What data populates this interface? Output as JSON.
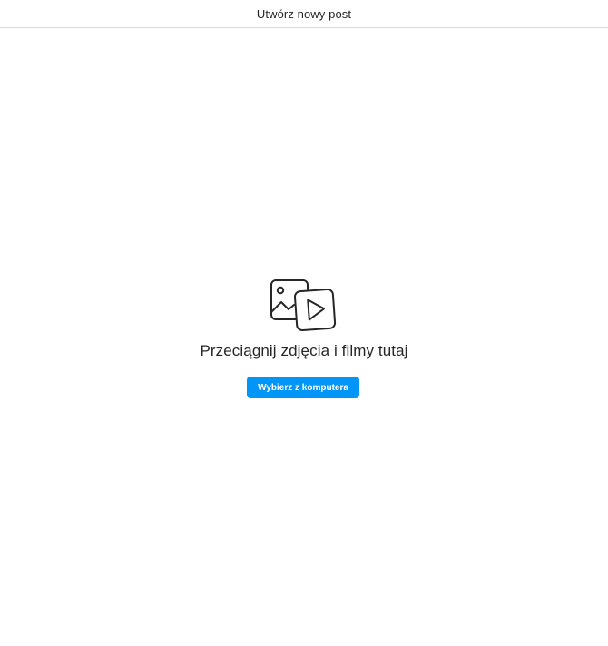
{
  "header": {
    "title": "Utwórz nowy post"
  },
  "dropzone": {
    "icon": "photo-video-icon",
    "instruction": "Przeciągnij zdjęcia i filmy tutaj",
    "select_button_label": "Wybierz z komputera"
  },
  "colors": {
    "accent": "#0095f6",
    "text": "#262626",
    "divider": "#dbdbdb",
    "background": "#ffffff"
  }
}
